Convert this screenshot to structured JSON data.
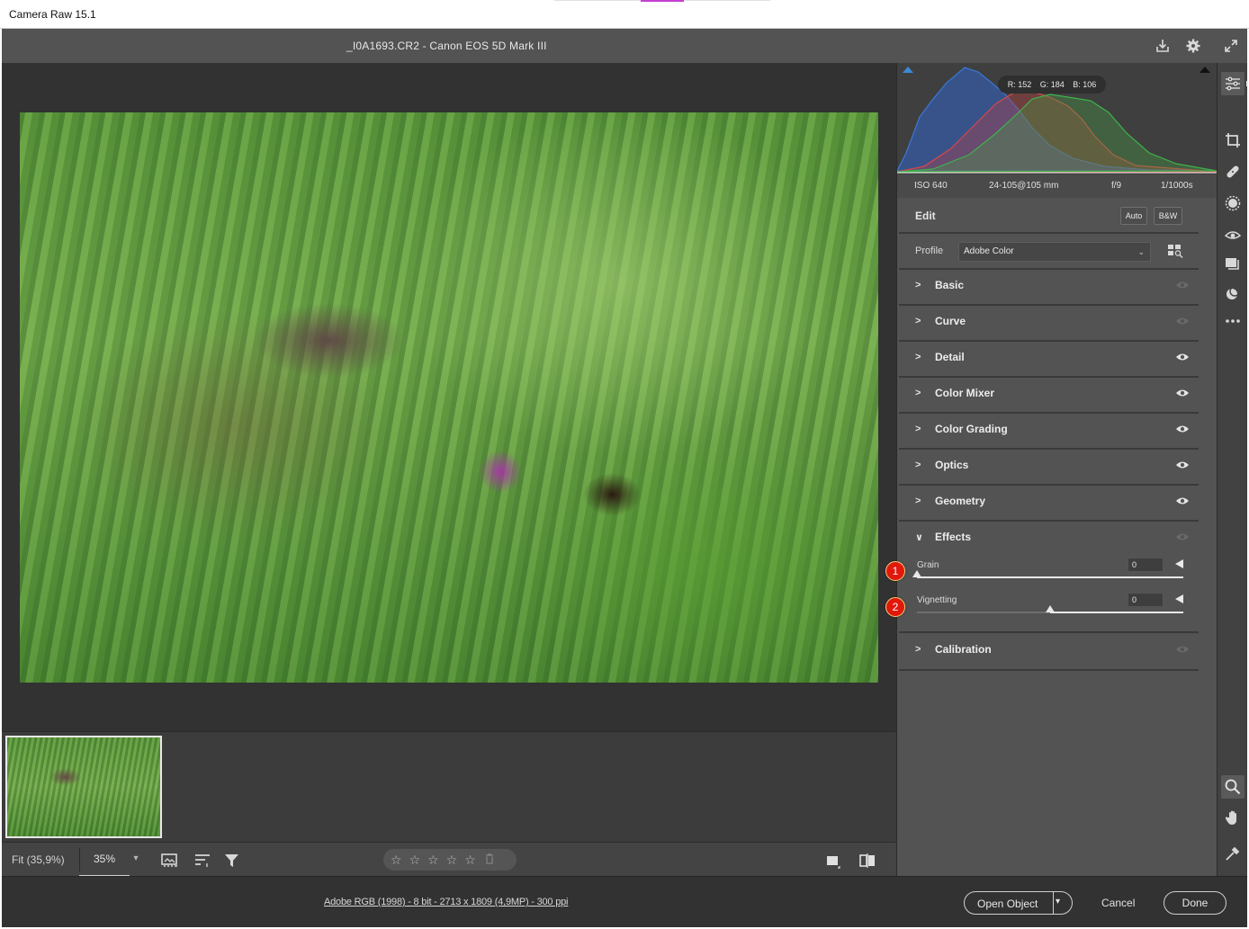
{
  "window": {
    "title": "Camera Raw 15.1"
  },
  "header": {
    "file_title": "_I0A1693.CR2  -  Canon EOS 5D Mark III"
  },
  "histogram": {
    "r_label": "R: 152",
    "g_label": "G: 184",
    "b_label": "B: 106"
  },
  "exif": {
    "iso": "ISO 640",
    "lens": "24-105@105 mm",
    "aperture": "f/9",
    "shutter": "1/1000s"
  },
  "edit": {
    "title": "Edit",
    "auto_label": "Auto",
    "bw_label": "B&W",
    "profile_label": "Profile",
    "profile_value": "Adobe Color"
  },
  "sections": {
    "basic": "Basic",
    "curve": "Curve",
    "detail": "Detail",
    "color_mixer": "Color Mixer",
    "color_grading": "Color Grading",
    "optics": "Optics",
    "geometry": "Geometry",
    "effects": "Effects",
    "calibration": "Calibration"
  },
  "effects": {
    "grain_label": "Grain",
    "grain_value": "0",
    "grain_position": 0.0,
    "vignetting_label": "Vignetting",
    "vignetting_value": "0",
    "vignetting_position": 0.5
  },
  "callouts": {
    "one": "1",
    "two": "2"
  },
  "viewbar": {
    "fit_label": "Fit (35,9%)",
    "zoom_value": "35%",
    "stars": [
      "☆",
      "☆",
      "☆",
      "☆",
      "☆"
    ],
    "star_count": 0
  },
  "statusbar": {
    "info_link": "Adobe RGB (1998) - 8 bit - 2713 x 1809 (4,9MP) - 300 ppi",
    "open_object_label": "Open Object",
    "cancel_label": "Cancel",
    "done_label": "Done"
  },
  "icons": {
    "save": "save-icon",
    "settings": "gear-icon",
    "fullscreen": "fullscreen-icon",
    "edit_tool": "sliders-icon",
    "crop": "crop-icon",
    "heal": "bandage-icon",
    "mask": "mask-icon",
    "redeye": "red-eye-icon",
    "snapshots": "snapshots-icon",
    "presets": "presets-icon",
    "more": "more-icon",
    "zoom": "zoom-icon",
    "hand": "hand-icon",
    "color_sampler": "color-sampler-icon",
    "grid": "grid-icon"
  },
  "colors": {
    "accent_badge": "#e1180b",
    "panel_bg": "#535353",
    "app_bg": "#323232"
  }
}
